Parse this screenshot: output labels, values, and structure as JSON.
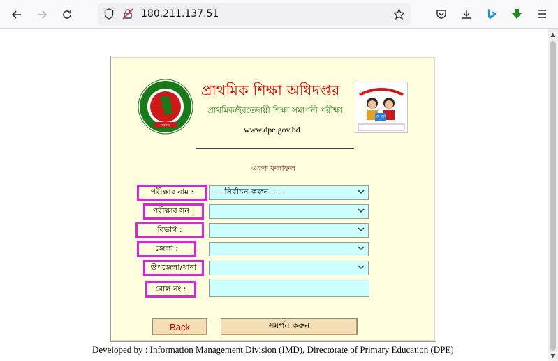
{
  "browser": {
    "url": "180.211.137.51",
    "icons": [
      "back-arrow-icon",
      "forward-arrow-icon",
      "reload-icon",
      "shield-icon",
      "insecure-lock-icon",
      "bookmark-star-icon",
      "pocket-icon",
      "download-icon",
      "bing-icon",
      "green-download-arrow-icon",
      "menu-icon"
    ]
  },
  "header": {
    "title": "প্রাথমিক শিক্ষা অধিদপ্তর",
    "subtitle": "প্রাথমিক/ইবতেদায়ী শিক্ষা সমাপনী পরীক্ষা",
    "website": "www.dpe.gov.bd",
    "logo_left_text": "গণপ্রজাতন্ত্রী বাংলাদেশ সরকার",
    "logo_right_text": "প্রাথমিক শিক্ষা অধিদপ্তর"
  },
  "form": {
    "section_title": "একক ফলাফল",
    "exam_name_label": "পরীক্ষার নাম :",
    "exam_name_value": "----নির্বাচন করুন----",
    "exam_year_label": "পরীক্ষার সন :",
    "exam_year_value": "",
    "division_label": "বিভাগ :",
    "division_value": "",
    "district_label": "জেলা :",
    "district_value": "",
    "upazila_label": "উপজেলা/থানা",
    "upazila_value": "",
    "roll_label": "রোল নং :",
    "roll_value": "",
    "back_button": "Back",
    "submit_button": "সমর্পন করুন"
  },
  "footer": {
    "text": "Developed by : Information Management Division (IMD), Directorate of Primary Education (DPE)"
  },
  "colors": {
    "panel_bg": "#ffffdd",
    "title_red": "#e00000",
    "subtitle_green": "#1a8a1a",
    "label_border": "#e020e0",
    "input_bg": "#ccffff",
    "button_bg": "#f5deb3"
  }
}
